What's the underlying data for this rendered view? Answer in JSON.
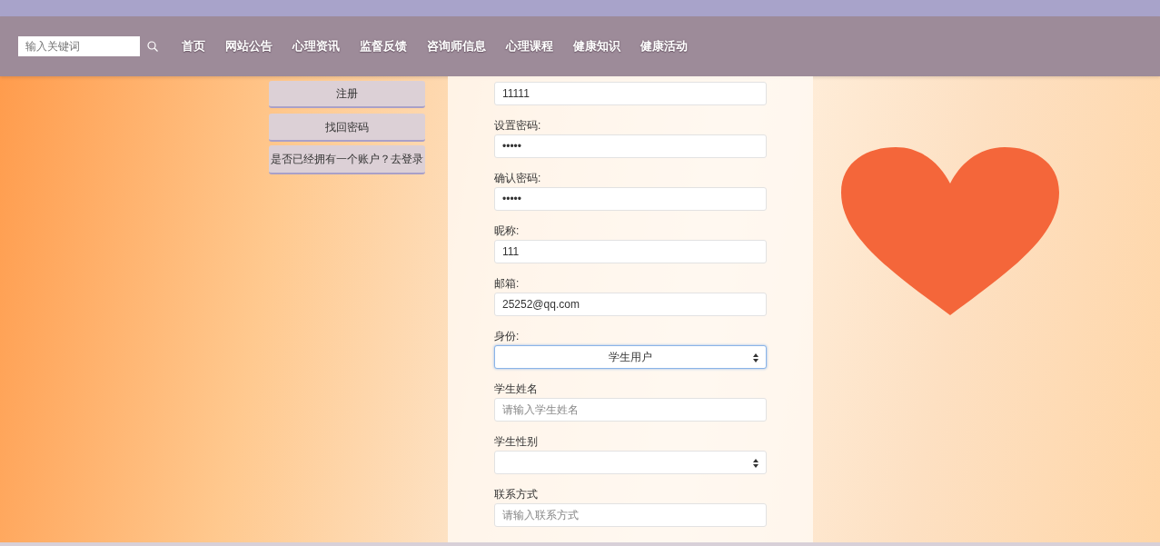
{
  "search": {
    "placeholder": "输入关键词"
  },
  "nav": [
    "首页",
    "网站公告",
    "心理资讯",
    "监督反馈",
    "咨询师信息",
    "心理课程",
    "健康知识",
    "健康活动"
  ],
  "side_buttons": [
    "注册",
    "找回密码",
    "是否已经拥有一个账户？去登录"
  ],
  "form": [
    {
      "kind": "input",
      "value": "11111",
      "focused": false
    },
    {
      "label": "设置密码:",
      "kind": "input",
      "value": "•••••",
      "focused": false
    },
    {
      "label": "确认密码:",
      "kind": "input",
      "value": "•••••",
      "focused": false
    },
    {
      "label": "昵称:",
      "kind": "input",
      "value": "111",
      "focused": false
    },
    {
      "label": "邮箱:",
      "kind": "input",
      "value": "25252@qq.com",
      "focused": false
    },
    {
      "label": "身份:",
      "kind": "select",
      "value": "学生用户",
      "focused": true
    },
    {
      "label": "学生姓名",
      "kind": "input",
      "placeholder": "请输入学生姓名",
      "focused": false
    },
    {
      "label": "学生性别",
      "kind": "select",
      "focused": false
    },
    {
      "label": "联系方式",
      "kind": "input",
      "placeholder": "请输入联系方式",
      "focused": false
    }
  ]
}
